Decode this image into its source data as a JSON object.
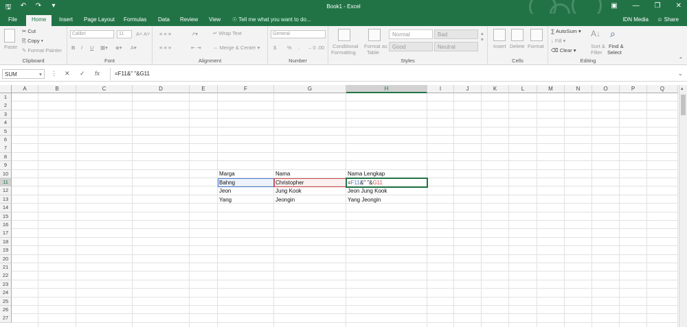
{
  "window": {
    "title": "Book1 - Excel"
  },
  "tabs": {
    "file": "File",
    "home": "Home",
    "insert": "Insert",
    "page_layout": "Page Layout",
    "formulas": "Formulas",
    "data": "Data",
    "review": "Review",
    "view": "View"
  },
  "tell_me": "Tell me what you want to do...",
  "account": {
    "user": "IDN Media",
    "share": "Share"
  },
  "ribbon": {
    "clipboard": {
      "paste": "Paste",
      "cut": "Cut",
      "copy": "Copy",
      "format_painter": "Format Painter",
      "label": "Clipboard"
    },
    "font": {
      "name": "Calibri",
      "size": "11",
      "label": "Font",
      "bold": "B",
      "italic": "I",
      "underline": "U"
    },
    "alignment": {
      "wrap_text": "Wrap Text",
      "merge_center": "Merge & Center",
      "label": "Alignment"
    },
    "number": {
      "format": "General",
      "currency": "$",
      "percent": "%",
      "comma": ",",
      "label": "Number"
    },
    "styles": {
      "conditional_formatting": "Conditional",
      "conditional_formatting_2": "Formatting",
      "format_as_table": "Format as",
      "format_as_table_2": "Table",
      "normal": "Normal",
      "bad": "Bad",
      "good": "Good",
      "neutral": "Neutral",
      "label": "Styles"
    },
    "cells": {
      "insert": "Insert",
      "delete": "Delete",
      "format": "Format",
      "label": "Cells"
    },
    "editing": {
      "autosum": "AutoSum",
      "fill": "Fill",
      "clear": "Clear",
      "sort_filter": "Sort &",
      "sort_filter_2": "Filter",
      "find_select": "Find &",
      "find_select_2": "Select",
      "label": "Editing"
    }
  },
  "formula_bar": {
    "name_box": "SUM",
    "cancel": "✕",
    "enter": "✓",
    "fx": "fx",
    "formula": "=F11&\" \"&G11"
  },
  "grid": {
    "columns": [
      "A",
      "B",
      "C",
      "D",
      "E",
      "F",
      "G",
      "H",
      "I",
      "J",
      "K",
      "L",
      "M",
      "N",
      "O",
      "P",
      "Q"
    ],
    "rows": [
      "1",
      "2",
      "3",
      "4",
      "5",
      "6",
      "7",
      "8",
      "9",
      "10",
      "11",
      "12",
      "13",
      "14",
      "15",
      "16",
      "17",
      "18",
      "19",
      "20",
      "21",
      "22",
      "23",
      "24",
      "25",
      "26",
      "27"
    ],
    "cells": {
      "F10": "Marga",
      "G10": "Nama",
      "H10": "Nama Lengkap",
      "F11": "Bahng",
      "G11": "Christopher",
      "F12": "Jeon",
      "G12": "Jung Kook",
      "H12": "Jeon Jung Kook",
      "F13": "Yang",
      "G13": "Jeongin",
      "H13": "Yang Jeongin"
    },
    "edit_formula": {
      "part1": "=",
      "part2": "F11",
      "part3": "&\" \"&",
      "part4": "G11"
    }
  },
  "colors": {
    "accent": "#217346",
    "ref_blue": "#4a7fd0",
    "ref_red": "#d04a4a"
  }
}
